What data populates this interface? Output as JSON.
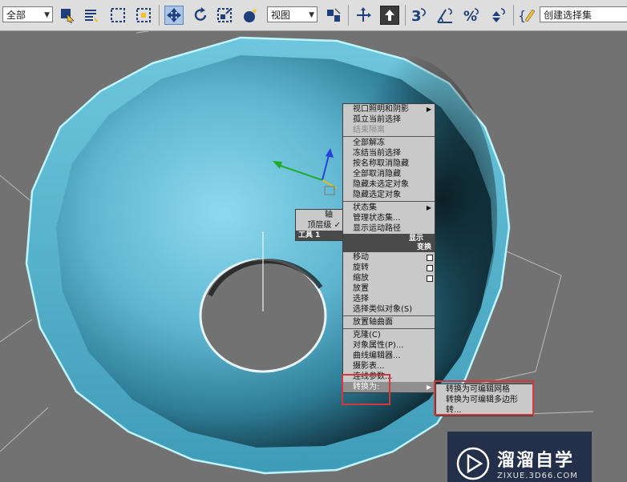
{
  "toolbar": {
    "selection_filter": "全部",
    "viewport_combo": "视图",
    "named_selection": "创建选择集",
    "icons": [
      "select-object-icon",
      "select-by-name-icon",
      "rect-selection-icon",
      "window-crossing-icon",
      "move-icon",
      "rotate-icon",
      "scale-icon",
      "fill-icon",
      "reference-coord-icon",
      "pivot-icon",
      "manipulate-icon",
      "keyboard-shortcut-icon",
      "snap-3-icon",
      "angle-snap-icon",
      "percent-snap-icon",
      "spinner-snap-icon",
      "edit-named-sets-icon"
    ]
  },
  "colors": {
    "mesh": "#7bc6df",
    "highlight": "#d23a3a",
    "toolbar_bg": "#dedede",
    "menu_bg": "#c9c9c9"
  },
  "quad_display": {
    "items": [
      {
        "label": "视口照明和阴影",
        "sub": "▶"
      },
      {
        "label": "孤立当前选择"
      },
      {
        "label": "结束隔离",
        "disabled": true
      },
      {
        "sep": true
      },
      {
        "label": "全部解冻"
      },
      {
        "label": "冻结当前选择"
      },
      {
        "label": "按名称取消隐藏"
      },
      {
        "label": "全部取消隐藏"
      },
      {
        "label": "隐藏未选定对象"
      },
      {
        "label": "隐藏选定对象"
      },
      {
        "sep": true
      },
      {
        "label": "状态集",
        "sub": "▶"
      },
      {
        "label": "管理状态集..."
      },
      {
        "label": "显示运动路径"
      }
    ],
    "header": "显示"
  },
  "quad_tools": {
    "items": [
      {
        "label": "轴"
      },
      {
        "label": "顶层级 ✓"
      }
    ],
    "header": "工具 1"
  },
  "quad_transform": {
    "header": "变换",
    "items": [
      {
        "label": "移动",
        "box": true
      },
      {
        "label": "旋转",
        "box": true
      },
      {
        "label": "缩放",
        "box": true
      },
      {
        "label": "放置"
      },
      {
        "label": "选择"
      },
      {
        "label": "选择类似对象(S)"
      },
      {
        "sep": true
      },
      {
        "label": "放置轴曲面"
      },
      {
        "sep": true
      },
      {
        "label": "克隆(C)"
      },
      {
        "label": "对象属性(P)..."
      },
      {
        "label": "曲线编辑器..."
      },
      {
        "label": "摄影表..."
      },
      {
        "label": "连线参数..."
      },
      {
        "label": "转换为:",
        "sub": "▶",
        "highlight": true
      }
    ]
  },
  "convert_submenu": {
    "items": [
      {
        "label": "转换为可编辑网格"
      },
      {
        "label": "转换为可编辑多边形"
      },
      {
        "label": "转..."
      }
    ]
  },
  "watermark": {
    "title": "溜溜自学",
    "url": "ZIXUE.3D66.COM"
  }
}
